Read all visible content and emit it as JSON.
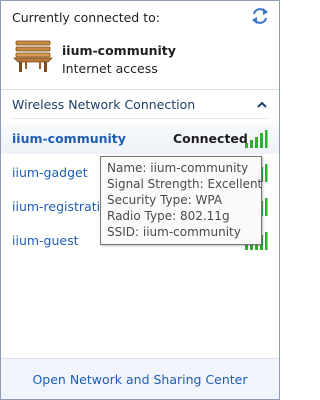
{
  "header": {
    "title": "Currently connected to:",
    "refresh_icon": "refresh-icon"
  },
  "current_network": {
    "icon": "bench-network-icon",
    "name": "iium-community",
    "status": "Internet access"
  },
  "section": {
    "label": "Wireless Network Connection",
    "collapse_icon": "chevron-up-icon"
  },
  "networks": [
    {
      "name": "iium-community",
      "status": "Connected",
      "signal": "excellent"
    },
    {
      "name": "iium-gadget",
      "status": "",
      "signal": "excellent"
    },
    {
      "name": "iium-registration",
      "status": "",
      "signal": "excellent"
    },
    {
      "name": "iium-guest",
      "status": "",
      "signal": "excellent"
    }
  ],
  "tooltip": {
    "lines": [
      "Name: iium-community",
      "Signal Strength: Excellent",
      "Security Type: WPA",
      "Radio Type: 802.11g",
      "SSID: iium-community"
    ]
  },
  "footer": {
    "link": "Open Network and Sharing Center"
  },
  "colors": {
    "link": "#1f5db5",
    "signal_green": "#2fae2f",
    "footer_bg": "#f1f5fb",
    "border": "#8e9cb1"
  }
}
